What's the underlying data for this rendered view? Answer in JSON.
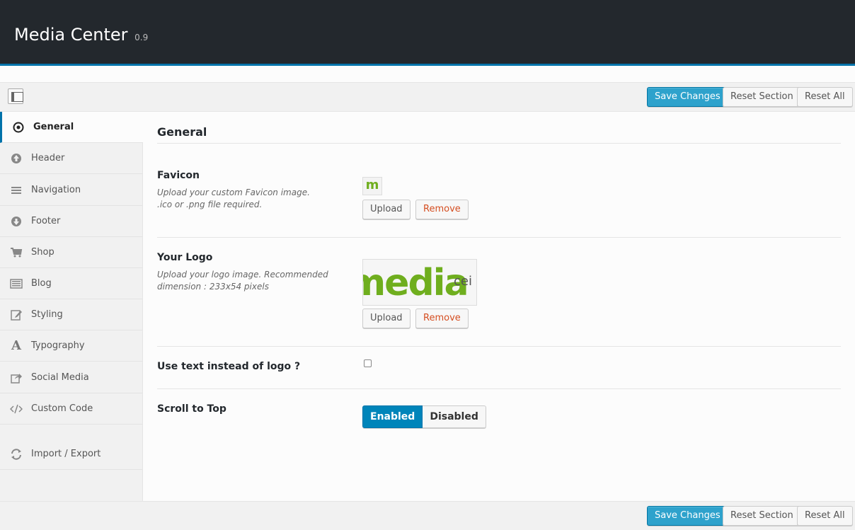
{
  "header": {
    "title": "Media Center",
    "version": "0.9"
  },
  "toolbar": {
    "save": "Save Changes",
    "reset_section": "Reset Section",
    "reset_all": "Reset All"
  },
  "sidebar": {
    "items": [
      {
        "label": "General",
        "icon": "radio-target-icon"
      },
      {
        "label": "Header",
        "icon": "arrow-up-circle-icon"
      },
      {
        "label": "Navigation",
        "icon": "menu-lines-icon"
      },
      {
        "label": "Footer",
        "icon": "arrow-down-circle-icon"
      },
      {
        "label": "Shop",
        "icon": "cart-icon"
      },
      {
        "label": "Blog",
        "icon": "list-icon"
      },
      {
        "label": "Styling",
        "icon": "edit-icon"
      },
      {
        "label": "Typography",
        "icon": "font-a-icon"
      },
      {
        "label": "Social Media",
        "icon": "share-icon"
      },
      {
        "label": "Custom Code",
        "icon": "code-icon"
      },
      {
        "label": "Import / Export",
        "icon": "refresh-icon"
      }
    ]
  },
  "main": {
    "section_title": "General",
    "favicon": {
      "title": "Favicon",
      "desc_line1": "Upload your custom Favicon image.",
      "desc_line2": ".ico or .png file required.",
      "preview": "m",
      "upload": "Upload",
      "remove": "Remove"
    },
    "logo": {
      "title": "Your Logo",
      "desc_line1": "Upload your logo image. Recommended",
      "desc_line2": "dimension : 233x54 pixels",
      "preview_text": "media",
      "preview_sub": "cei",
      "upload": "Upload",
      "remove": "Remove"
    },
    "text_logo": {
      "title": "Use text instead of logo ?",
      "checked": false
    },
    "scroll_top": {
      "title": "Scroll to Top",
      "enabled": "Enabled",
      "disabled": "Disabled",
      "value": "Enabled"
    }
  },
  "colors": {
    "accent": "#0073aa",
    "primary_button": "#2ea2cc",
    "logo_green": "#6fae1e",
    "remove_red": "#d54e21",
    "topbar": "#23282d"
  }
}
